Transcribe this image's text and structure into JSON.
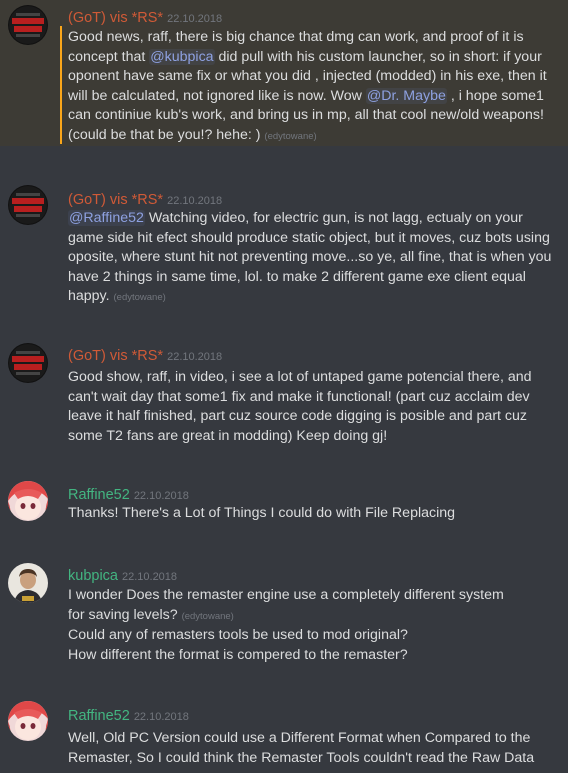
{
  "messages": [
    {
      "author": "(GoT) vis *RS*",
      "timestamp": "22.10.2018",
      "text_1": "Good news, raff, there is big chance that dmg can work, and proof of it is concept that ",
      "mention_1": "@kubpica",
      "text_2": "  did pull with his custom launcher, so in short: if your oponent have same fix or what you did , injected (modded) in his exe, then it will be calculated, not ignored like is now. Wow ",
      "mention_2": "@Dr. Maybe",
      "text_3": " , i hope some1 can continiue kub's work, and bring us in mp, all that cool new/old weapons! (could be that be you!? hehe: ) ",
      "edited": "(edytowane)"
    },
    {
      "author": "(GoT) vis *RS*",
      "timestamp": "22.10.2018",
      "mention_1": "@Raffine52",
      "text_1": "  Watching video, for electric gun, is not lagg, ectualy on your game side hit efect should produce static object, but it moves, cuz bots using oposite, where stunt hit not preventing move...so ye, all fine, that is when you have 2 things in same time, lol. to make 2 different game exe client equal happy. ",
      "edited": "(edytowane)"
    },
    {
      "author": "(GoT) vis *RS*",
      "timestamp": "22.10.2018",
      "text_1": "Good show, raff, in video, i see a lot of untaped game potencial there, and can't wait day that some1 fix and make it functional! (part cuz acclaim dev leave it half finished, part cuz source code digging is posible and part cuz some T2 fans are great in modding) Keep doing gj!"
    },
    {
      "author": "Raffine52",
      "timestamp": "22.10.2018",
      "text_1": "Thanks! There's a Lot of Things I could do with File Replacing"
    },
    {
      "author": "kubpica",
      "timestamp": "22.10.2018",
      "line_1": "I wonder Does the remaster engine use a completely different system for saving levels? ",
      "edited": "(edytowane)",
      "line_2": "Could any of remasters tools be used to mod original?",
      "line_3": "How different the format is compered to the remaster?"
    },
    {
      "author": "Raffine52",
      "timestamp": "22.10.2018",
      "text_1": "Well, Old PC Version could use a Different Format when Compared to the Remaster, So I could think the Remaster Tools couldn't read the Raw Data"
    }
  ],
  "colors": {
    "background": "#36393f",
    "highlight_bg": "#3d3b35",
    "highlight_bar": "#faa61a",
    "got_name": "#d05a37",
    "green_name": "#43b581",
    "mention": "#8ea1e1",
    "timestamp": "#72767d"
  },
  "icons": {
    "got_avatar": "multiplayer-logo-avatar",
    "raffine_avatar": "anime-girl-avatar",
    "kubpica_avatar": "person-avatar"
  }
}
